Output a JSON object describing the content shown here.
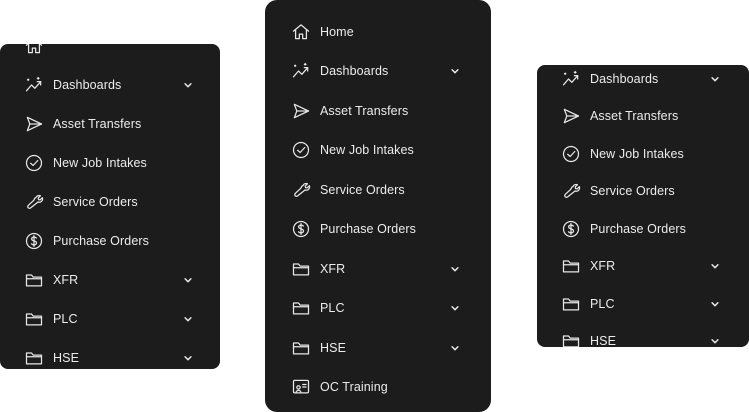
{
  "left": {
    "items": [
      {
        "label": ""
      },
      {
        "label": "Dashboards"
      },
      {
        "label": "Asset Transfers"
      },
      {
        "label": "New Job Intakes"
      },
      {
        "label": "Service Orders"
      },
      {
        "label": "Purchase Orders"
      },
      {
        "label": "XFR"
      },
      {
        "label": "PLC"
      },
      {
        "label": "HSE"
      }
    ]
  },
  "center": {
    "items": [
      {
        "label": "Home"
      },
      {
        "label": "Dashboards"
      },
      {
        "label": "Asset Transfers"
      },
      {
        "label": "New Job Intakes"
      },
      {
        "label": "Service Orders"
      },
      {
        "label": "Purchase Orders"
      },
      {
        "label": "XFR"
      },
      {
        "label": "PLC"
      },
      {
        "label": "HSE"
      },
      {
        "label": "OC Training"
      }
    ]
  },
  "right": {
    "items": [
      {
        "label": "Dashboards"
      },
      {
        "label": "Asset Transfers"
      },
      {
        "label": "New Job Intakes"
      },
      {
        "label": "Service Orders"
      },
      {
        "label": "Purchase Orders"
      },
      {
        "label": "XFR"
      },
      {
        "label": "PLC"
      },
      {
        "label": "HSE"
      }
    ]
  },
  "colors": {
    "panel_bg": "#1c1c1c",
    "text": "#ececec",
    "icon": "#e6e6e6"
  }
}
